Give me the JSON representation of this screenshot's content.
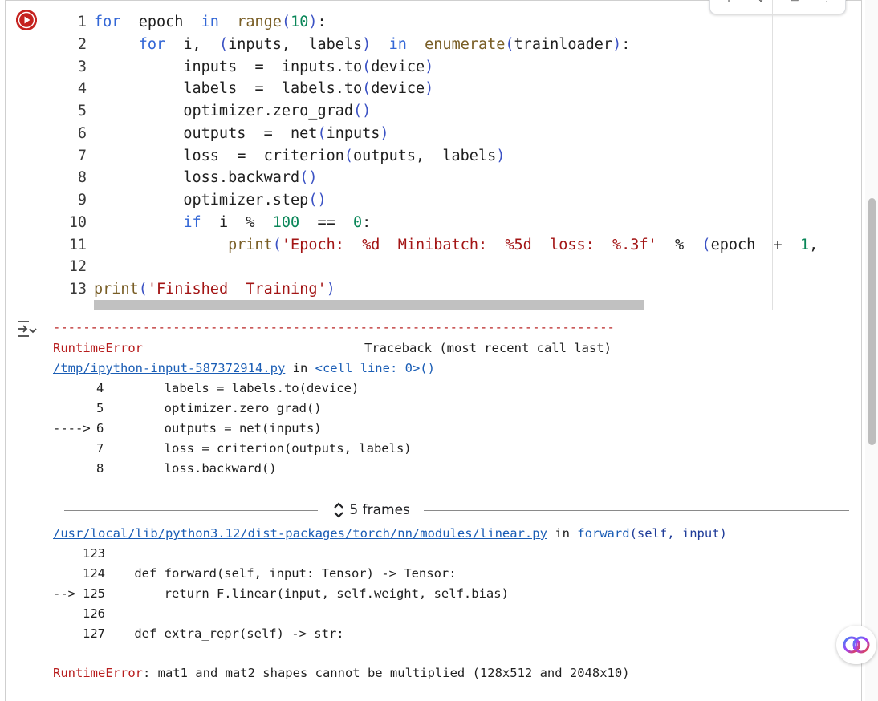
{
  "toolbar": {
    "icons": [
      "arrow-up-icon",
      "arrow-down-icon",
      "delete-icon",
      "more-icon"
    ]
  },
  "code": {
    "line_numbers": [
      "1",
      "2",
      "3",
      "4",
      "5",
      "6",
      "7",
      "8",
      "9",
      "10",
      "11",
      "12",
      "13"
    ],
    "lines": [
      [
        {
          "t": "for",
          "c": "kw"
        },
        {
          "t": "  epoch  "
        },
        {
          "t": "in",
          "c": "kw"
        },
        {
          "t": "  "
        },
        {
          "t": "range",
          "c": "fn"
        },
        {
          "t": "(",
          "c": "bl"
        },
        {
          "t": "10",
          "c": "num"
        },
        {
          "t": ")",
          "c": "bl"
        },
        {
          "t": ":"
        }
      ],
      [
        {
          "t": "     "
        },
        {
          "t": "for",
          "c": "kw"
        },
        {
          "t": "  i,  "
        },
        {
          "t": "(",
          "c": "bl"
        },
        {
          "t": "inputs,  labels"
        },
        {
          "t": ")",
          "c": "bl"
        },
        {
          "t": "  "
        },
        {
          "t": "in",
          "c": "kw"
        },
        {
          "t": "  "
        },
        {
          "t": "enumerate",
          "c": "fn"
        },
        {
          "t": "(",
          "c": "bl"
        },
        {
          "t": "trainloader"
        },
        {
          "t": ")",
          "c": "bl"
        },
        {
          "t": ":"
        }
      ],
      [
        {
          "t": "          inputs  =  inputs.to"
        },
        {
          "t": "(",
          "c": "bl"
        },
        {
          "t": "device"
        },
        {
          "t": ")",
          "c": "bl"
        }
      ],
      [
        {
          "t": "          labels  =  labels.to"
        },
        {
          "t": "(",
          "c": "bl"
        },
        {
          "t": "device"
        },
        {
          "t": ")",
          "c": "bl"
        }
      ],
      [
        {
          "t": "          optimizer.zero_grad"
        },
        {
          "t": "()",
          "c": "bl"
        }
      ],
      [
        {
          "t": "          outputs  =  net"
        },
        {
          "t": "(",
          "c": "bl"
        },
        {
          "t": "inputs"
        },
        {
          "t": ")",
          "c": "bl"
        }
      ],
      [
        {
          "t": "          loss  =  criterion"
        },
        {
          "t": "(",
          "c": "bl"
        },
        {
          "t": "outputs,  labels"
        },
        {
          "t": ")",
          "c": "bl"
        }
      ],
      [
        {
          "t": "          loss.backward"
        },
        {
          "t": "()",
          "c": "bl"
        }
      ],
      [
        {
          "t": "          optimizer.step"
        },
        {
          "t": "()",
          "c": "bl"
        }
      ],
      [
        {
          "t": "          "
        },
        {
          "t": "if",
          "c": "kw"
        },
        {
          "t": "  i  %  "
        },
        {
          "t": "100",
          "c": "num"
        },
        {
          "t": "  ==  "
        },
        {
          "t": "0",
          "c": "num"
        },
        {
          "t": ":"
        }
      ],
      [
        {
          "t": "               "
        },
        {
          "t": "print",
          "c": "fn"
        },
        {
          "t": "(",
          "c": "bl"
        },
        {
          "t": "'Epoch:  %d  Minibatch:  %5d  loss:  %.3f'",
          "c": "str"
        },
        {
          "t": "  %  "
        },
        {
          "t": "(",
          "c": "bl"
        },
        {
          "t": "epoch  +  "
        },
        {
          "t": "1",
          "c": "num"
        },
        {
          "t": ","
        }
      ],
      [],
      [
        {
          "t": "print",
          "c": "fn"
        },
        {
          "t": "(",
          "c": "bl"
        },
        {
          "t": "'Finished  Training'",
          "c": "str"
        },
        {
          "t": ")",
          "c": "bl"
        }
      ]
    ]
  },
  "output": {
    "dashes": "---------------------------------------------------------------------------",
    "error_name": "RuntimeError",
    "traceback_label": "Traceback (most recent call last)",
    "file1": "/tmp/ipython-input-587372914.py",
    "in_word": " in ",
    "cell_line": "<cell line: 0>",
    "cell_parens": "()",
    "tb1": [
      {
        "arrow": "     ",
        "num": "4",
        "code": "        labels = labels.to(device)"
      },
      {
        "arrow": "     ",
        "num": "5",
        "code": "        optimizer.zero_grad()"
      },
      {
        "arrow": "----> ",
        "num": "6",
        "code": "        outputs = net(inputs)"
      },
      {
        "arrow": "     ",
        "num": "7",
        "code": "        loss = criterion(outputs, labels)"
      },
      {
        "arrow": "     ",
        "num": "8",
        "code": "        loss.backward()"
      }
    ],
    "frames_label": "5 frames",
    "file2": "/usr/local/lib/python3.12/dist-packages/torch/nn/modules/linear.py",
    "func2": "forward",
    "func2_args": "(self, input)",
    "tb2": [
      {
        "arrow": "    ",
        "num": "123",
        "code": ""
      },
      {
        "arrow": "    ",
        "num": "124",
        "code": "    def forward(self, input: Tensor) -> Tensor:"
      },
      {
        "arrow": "--> ",
        "num": "125",
        "code": "        return F.linear(input, self.weight, self.bias)"
      },
      {
        "arrow": "    ",
        "num": "126",
        "code": ""
      },
      {
        "arrow": "    ",
        "num": "127",
        "code": "    def extra_repr(self) -> str:"
      }
    ],
    "final_error_name": "RuntimeError",
    "final_error_msg": ": mat1 and mat2 shapes cannot be multiplied (128x512 and 2048x10)"
  }
}
